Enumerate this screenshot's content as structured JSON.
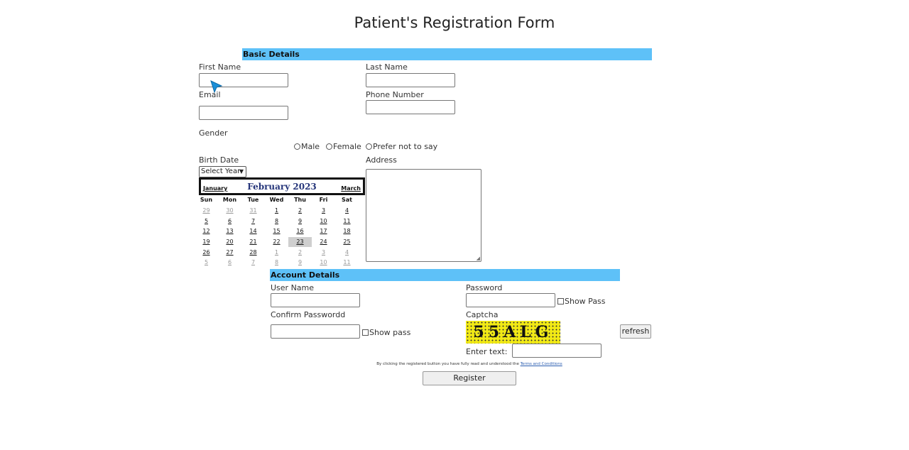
{
  "page": {
    "title": "Patient's Registration Form"
  },
  "basic": {
    "section_label": "Basic Details",
    "first_name_label": "First Name",
    "last_name_label": "Last Name",
    "email_label": "Email",
    "phone_label": "Phone Number",
    "gender_label": "Gender",
    "gender_options": [
      "Male",
      "Female",
      "Prefer not to say"
    ],
    "birth_date_label": "Birth Date",
    "year_select": "Select Year",
    "address_label": "Address"
  },
  "calendar": {
    "prev": "January",
    "month": "February 2023",
    "next": "March",
    "weekdays": [
      "Sun",
      "Mon",
      "Tue",
      "Wed",
      "Thu",
      "Fri",
      "Sat"
    ],
    "weeks": [
      [
        "29",
        "30",
        "31",
        "1",
        "2",
        "3",
        "4"
      ],
      [
        "5",
        "6",
        "7",
        "8",
        "9",
        "10",
        "11"
      ],
      [
        "12",
        "13",
        "14",
        "15",
        "16",
        "17",
        "18"
      ],
      [
        "19",
        "20",
        "21",
        "22",
        "23",
        "24",
        "25"
      ],
      [
        "26",
        "27",
        "28",
        "1",
        "2",
        "3",
        "4"
      ],
      [
        "5",
        "6",
        "7",
        "8",
        "9",
        "10",
        "11"
      ]
    ],
    "selected": "23"
  },
  "account": {
    "section_label": "Account Details",
    "username_label": "User Name",
    "password_label": "Password",
    "show_pass_label": "Show Pass",
    "confirm_label": "Confirm Passwordd",
    "show_pass2_label": "Show pass",
    "captcha_label": "Captcha",
    "captcha_text": "55ALG",
    "refresh_label": "refresh",
    "enter_text_label": "Enter text:"
  },
  "terms": {
    "text": "By clicking the registered button you have fully read and understood the",
    "link": "Terms and Conditions"
  },
  "register_label": "Register",
  "colors": {
    "section_bar": "#5ec1f8",
    "captcha_bg": "#f1e915",
    "cursor": "#1a8fd8"
  }
}
